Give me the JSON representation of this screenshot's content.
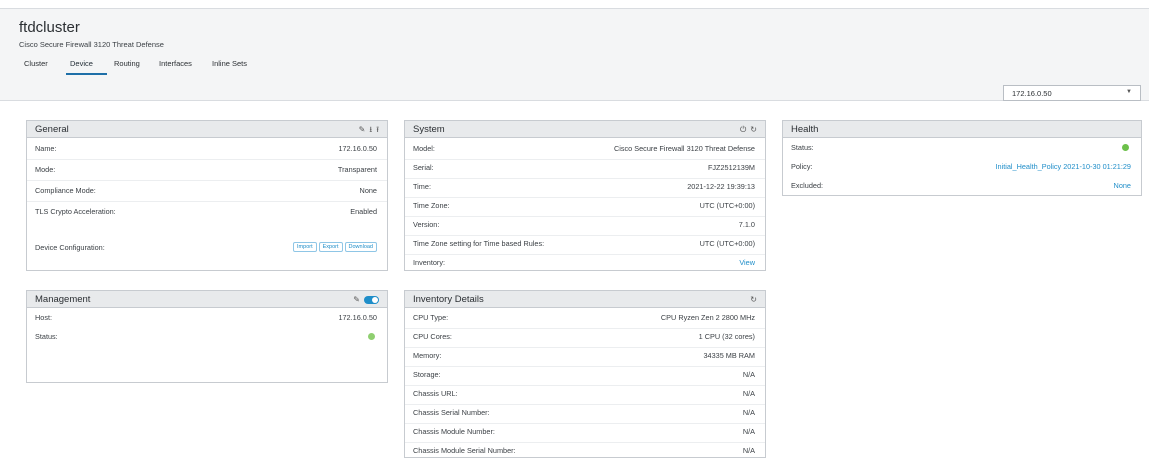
{
  "device": {
    "name": "ftdcluster",
    "subtitle": "Cisco Secure Firewall 3120 Threat Defense"
  },
  "tabs": [
    {
      "label": "Cluster"
    },
    {
      "label": "Device"
    },
    {
      "label": "Routing"
    },
    {
      "label": "Interfaces"
    },
    {
      "label": "Inline Sets"
    }
  ],
  "active_tab": "Device",
  "node_select": {
    "value": "172.16.0.50"
  },
  "general": {
    "title": "General",
    "rows": [
      {
        "label": "Name:",
        "value": "172.16.0.50"
      },
      {
        "label": "Mode:",
        "value": "Transparent"
      },
      {
        "label": "Compliance Mode:",
        "value": "None"
      },
      {
        "label": "TLS Crypto Acceleration:",
        "value": "Enabled"
      },
      {
        "label": "Device Configuration:",
        "value": ""
      }
    ],
    "buttons": {
      "import": "Import",
      "export": "Export",
      "download": "Download"
    }
  },
  "management": {
    "title": "Management",
    "rows": [
      {
        "label": "Host:",
        "value": "172.16.0.50"
      },
      {
        "label": "Status:",
        "value": ""
      }
    ]
  },
  "system": {
    "title": "System",
    "rows": [
      {
        "label": "Model:",
        "value": "Cisco Secure Firewall 3120 Threat Defense"
      },
      {
        "label": "Serial:",
        "value": "FJZ2512139M"
      },
      {
        "label": "Time:",
        "value": "2021-12-22 19:39:13"
      },
      {
        "label": "Time Zone:",
        "value": "UTC (UTC+0:00)"
      },
      {
        "label": "Version:",
        "value": "7.1.0"
      },
      {
        "label": "Time Zone setting for Time based Rules:",
        "value": "UTC (UTC+0:00)"
      },
      {
        "label": "Inventory:",
        "value": "View"
      }
    ]
  },
  "inventory": {
    "title": "Inventory Details",
    "rows": [
      {
        "label": "CPU Type:",
        "value": "CPU Ryzen Zen 2 2800 MHz"
      },
      {
        "label": "CPU Cores:",
        "value": "1 CPU (32 cores)"
      },
      {
        "label": "Memory:",
        "value": "34335 MB RAM"
      },
      {
        "label": "Storage:",
        "value": "N/A"
      },
      {
        "label": "Chassis URL:",
        "value": "N/A"
      },
      {
        "label": "Chassis Serial Number:",
        "value": "N/A"
      },
      {
        "label": "Chassis Module Number:",
        "value": "N/A"
      },
      {
        "label": "Chassis Module Serial Number:",
        "value": "N/A"
      }
    ]
  },
  "health": {
    "title": "Health",
    "rows": [
      {
        "label": "Status:",
        "value": ""
      },
      {
        "label": "Policy:",
        "value": "Initial_Health_Policy 2021-10-30 01:21:29"
      },
      {
        "label": "Excluded:",
        "value": "None"
      }
    ]
  },
  "colors": {
    "accent": "#1f8ec9",
    "tab_underline": "#1e6fa8",
    "status_ok": "#6cc04a"
  }
}
